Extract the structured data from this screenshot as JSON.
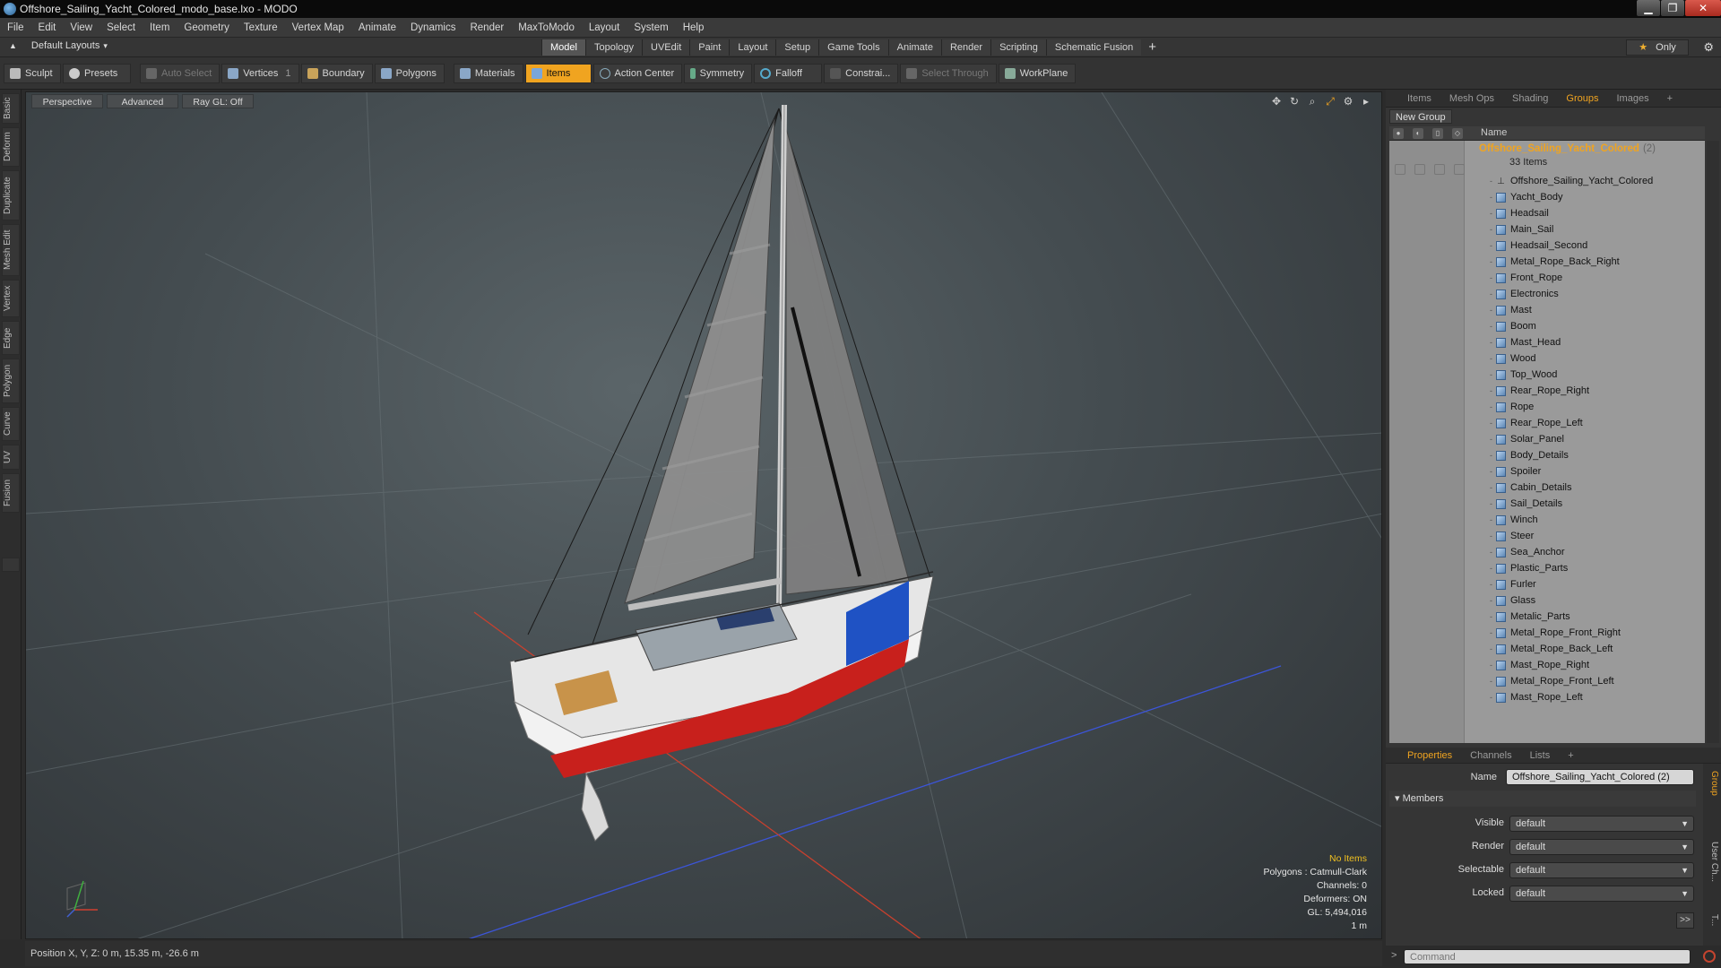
{
  "window": {
    "title": "Offshore_Sailing_Yacht_Colored_modo_base.lxo - MODO",
    "minimize": "▁",
    "restore": "❐",
    "close": "✕"
  },
  "menu": [
    "File",
    "Edit",
    "View",
    "Select",
    "Item",
    "Geometry",
    "Texture",
    "Vertex Map",
    "Animate",
    "Dynamics",
    "Render",
    "MaxToModo",
    "Layout",
    "System",
    "Help"
  ],
  "layout_selector": {
    "label": "Default Layouts",
    "arrow": "▾"
  },
  "mode_tabs": [
    "Model",
    "Topology",
    "UVEdit",
    "Paint",
    "Layout",
    "Setup",
    "Game Tools",
    "Animate",
    "Render",
    "Scripting",
    "Schematic Fusion"
  ],
  "active_mode_tab": "Model",
  "tab_add": "+",
  "only_button": {
    "star": "★",
    "label": "Only"
  },
  "gear": "⚙",
  "toolbar": {
    "sculpt": "Sculpt",
    "presets": "Presets",
    "auto_select": "Auto Select",
    "vertices": "Vertices",
    "vertices_count": "1",
    "boundary": "Boundary",
    "polygons": "Polygons",
    "materials": "Materials",
    "items": "Items",
    "action_center": "Action Center",
    "symmetry": "Symmetry",
    "falloff": "Falloff",
    "constrain": "Constrai...",
    "select_through": "Select Through",
    "workplane": "WorkPlane"
  },
  "left_tabs": [
    "Basic",
    "Deform",
    "Duplicate",
    "Mesh Edit",
    "Vertex",
    "Edge",
    "Polygon",
    "Curve",
    "UV",
    "Fusion"
  ],
  "viewport": {
    "projection": "Perspective",
    "shading": "Advanced",
    "raygl": "Ray GL: Off",
    "stats": {
      "selection": "No Items",
      "polygons": "Polygons : Catmull-Clark",
      "channels": "Channels: 0",
      "deformers": "Deformers: ON",
      "gl": "GL: 5,494,016",
      "scale": "1 m"
    },
    "icons": [
      "move-view-icon",
      "rotate-view-icon",
      "zoom-view-icon",
      "fit-view-icon",
      "settings-icon",
      "expand-icon"
    ]
  },
  "status_bar": {
    "position": "Position X, Y, Z:  0 m, 15.35 m, -26.6 m"
  },
  "right_panel": {
    "tabs": [
      "Items",
      "Mesh Ops",
      "Shading",
      "Groups",
      "Images"
    ],
    "active_tab": "Groups",
    "tab_add": "+",
    "new_group": "New Group",
    "name_column": "Name",
    "root": {
      "name": "Offshore_Sailing_Yacht_Colored",
      "count": "(2)",
      "subtitle": "33 Items"
    },
    "items": [
      "Offshore_Sailing_Yacht_Colored",
      "Yacht_Body",
      "Headsail",
      "Main_Sail",
      "Headsail_Second",
      "Metal_Rope_Back_Right",
      "Front_Rope",
      "Electronics",
      "Mast",
      "Boom",
      "Mast_Head",
      "Wood",
      "Top_Wood",
      "Rear_Rope_Right",
      "Rope",
      "Rear_Rope_Left",
      "Solar_Panel",
      "Body_Details",
      "Spoiler",
      "Cabin_Details",
      "Sail_Details",
      "Winch",
      "Steer",
      "Sea_Anchor",
      "Plastic_Parts",
      "Furler",
      "Glass",
      "Metalic_Parts",
      "Metal_Rope_Front_Right",
      "Metal_Rope_Back_Left",
      "Mast_Rope_Right",
      "Metal_Rope_Front_Left",
      "Mast_Rope_Left"
    ]
  },
  "properties": {
    "tabs": [
      "Properties",
      "Channels",
      "Lists"
    ],
    "active_tab": "Properties",
    "tab_add": "+",
    "name_label": "Name",
    "name_value": "Offshore_Sailing_Yacht_Colored (2)",
    "members_label": "Members",
    "rows": [
      {
        "label": "Visible",
        "value": "default"
      },
      {
        "label": "Render",
        "value": "default"
      },
      {
        "label": "Selectable",
        "value": "default"
      },
      {
        "label": "Locked",
        "value": "default"
      }
    ],
    "more": ">>",
    "side_tabs": [
      "Group",
      "User Ch...",
      "T..."
    ]
  },
  "command": {
    "placeholder": "Command",
    "prompt": ">"
  },
  "colors": {
    "accent": "#f0a420",
    "hull_red": "#c8201c",
    "hull_blue": "#1f52c4"
  }
}
